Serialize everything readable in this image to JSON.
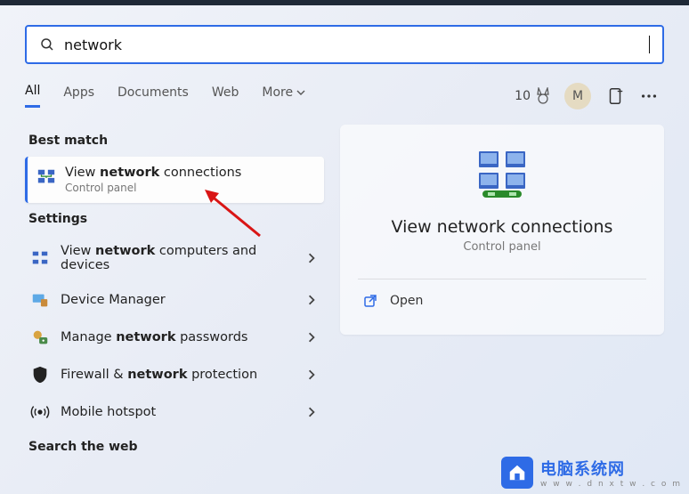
{
  "search": {
    "value": "network",
    "placeholder": ""
  },
  "tabs": {
    "all": "All",
    "apps": "Apps",
    "documents": "Documents",
    "web": "Web",
    "more": "More"
  },
  "header": {
    "points": "10",
    "avatar_initial": "M"
  },
  "sections": {
    "best_match": "Best match",
    "settings": "Settings",
    "search_web": "Search the web"
  },
  "best": {
    "title_pre": "View ",
    "title_bold": "network",
    "title_post": " connections",
    "subtitle": "Control panel"
  },
  "settings_items": [
    {
      "pre": "View ",
      "bold": "network",
      "post": " computers and devices",
      "icon": "network-devices-icon"
    },
    {
      "pre": "Device Manager",
      "bold": "",
      "post": "",
      "icon": "device-manager-icon"
    },
    {
      "pre": "Manage ",
      "bold": "network",
      "post": " passwords",
      "icon": "credentials-icon"
    },
    {
      "pre": "Firewall & ",
      "bold": "network",
      "post": " protection",
      "icon": "shield-icon"
    },
    {
      "pre": "Mobile hotspot",
      "bold": "",
      "post": "",
      "icon": "hotspot-icon"
    }
  ],
  "detail": {
    "title": "View network connections",
    "subtitle": "Control panel",
    "open": "Open"
  },
  "watermark": {
    "cn": "电脑系统网",
    "url": "w w w . d n x t w . c o m"
  }
}
